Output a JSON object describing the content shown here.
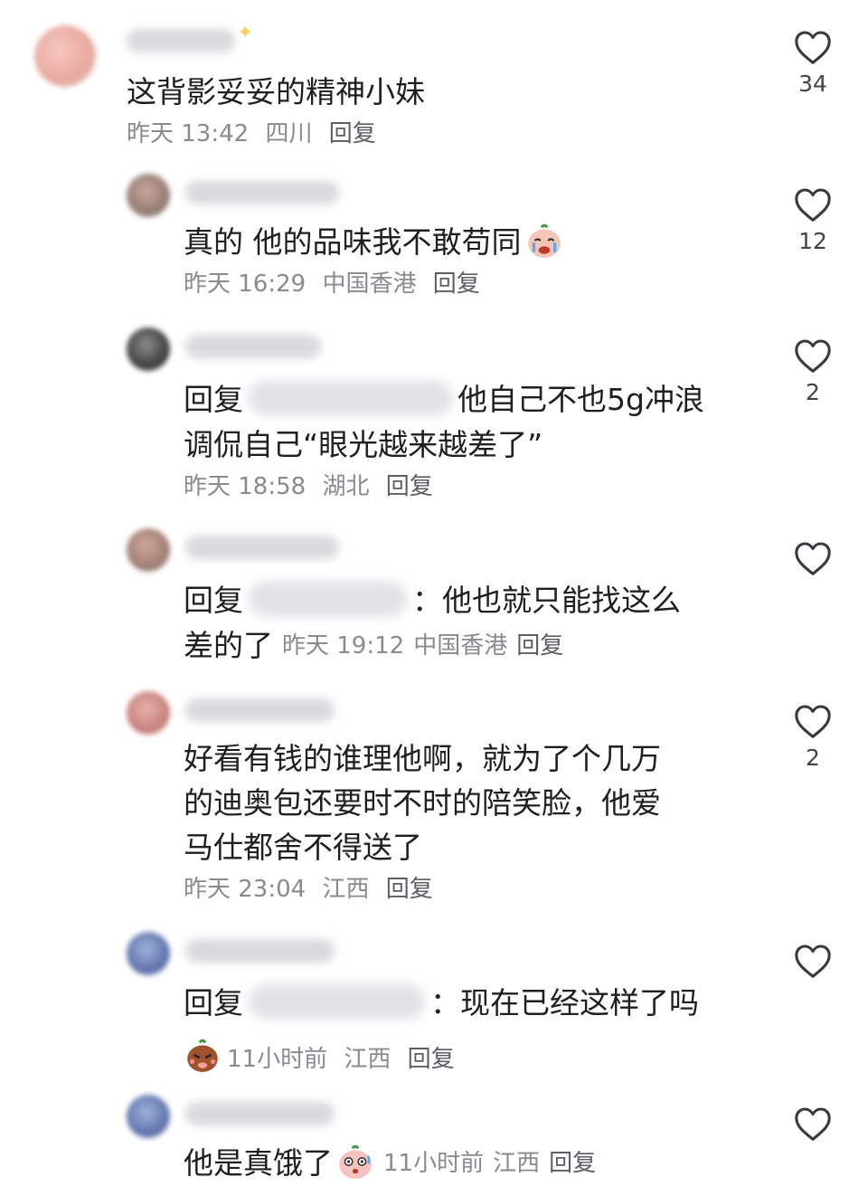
{
  "comments": [
    {
      "text": "这背影妥妥的精神小妹",
      "time": "昨天 13:42",
      "location": "四川",
      "reply_label": "回复",
      "likes": "34"
    },
    {
      "text": "真的 他的品味我不敢苟同",
      "time": "昨天 16:29",
      "location": "中国香港",
      "reply_label": "回复",
      "likes": "12"
    },
    {
      "text_prefix": "回复",
      "text_line1_rest": "他自己不也5g冲浪",
      "text_line2": "调侃自己“眼光越来越差了”",
      "time": "昨天 18:58",
      "location": "湖北",
      "reply_label": "回复",
      "likes": "2"
    },
    {
      "text_prefix": "回复",
      "text_line1_rest": "：他也就只能找这么",
      "text_line2": "差的了",
      "time": "昨天 19:12",
      "location": "中国香港",
      "reply_label": "回复",
      "likes": ""
    },
    {
      "text_line1": "好看有钱的谁理他啊，就为了个几万",
      "text_line2": "的迪奥包还要时不时的陪笑脸，他爱",
      "text_line3": "马仕都舍不得送了",
      "time": "昨天 23:04",
      "location": "江西",
      "reply_label": "回复",
      "likes": "2"
    },
    {
      "text_prefix": "回复",
      "text_line1_rest": "：现在已经这样了吗",
      "time": "11小时前",
      "location": "江西",
      "reply_label": "回复",
      "likes": ""
    },
    {
      "text": "他是真饿了",
      "time": "11小时前",
      "location": "江西",
      "reply_label": "回复",
      "likes": ""
    }
  ],
  "icons": {
    "like": "heart-outline-icon",
    "crying_emoji": "crying-emoji-icon",
    "angry_emoji": "angry-emoji-icon",
    "shocked_emoji": "shocked-emoji-icon"
  },
  "colors": {
    "text": "#1f1f1f",
    "meta": "#8a8a8f",
    "icon": "#3a3a3e"
  }
}
